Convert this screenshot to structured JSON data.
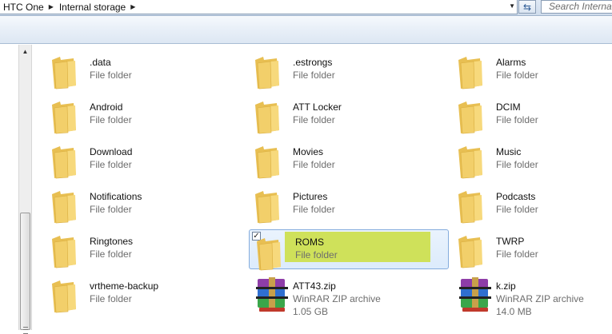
{
  "address": {
    "crumbs": [
      "HTC One",
      "Internal storage"
    ],
    "search_placeholder": "Search Internal storage"
  },
  "colors": {
    "selection_highlight": "#cfe15a",
    "selection_border": "#84acdd",
    "folder": "#f2cf6a"
  },
  "items": [
    {
      "name": ".data",
      "type": "File folder",
      "icon": "folder-icon"
    },
    {
      "name": ".estrongs",
      "type": "File folder",
      "icon": "folder-icon"
    },
    {
      "name": "Alarms",
      "type": "File folder",
      "icon": "folder-icon"
    },
    {
      "name": "Android",
      "type": "File folder",
      "icon": "folder-icon"
    },
    {
      "name": "ATT Locker",
      "type": "File folder",
      "icon": "folder-icon"
    },
    {
      "name": "DCIM",
      "type": "File folder",
      "icon": "folder-icon"
    },
    {
      "name": "Download",
      "type": "File folder",
      "icon": "folder-icon"
    },
    {
      "name": "Movies",
      "type": "File folder",
      "icon": "folder-icon"
    },
    {
      "name": "Music",
      "type": "File folder",
      "icon": "folder-icon"
    },
    {
      "name": "Notifications",
      "type": "File folder",
      "icon": "folder-icon"
    },
    {
      "name": "Pictures",
      "type": "File folder",
      "icon": "folder-icon"
    },
    {
      "name": "Podcasts",
      "type": "File folder",
      "icon": "folder-icon"
    },
    {
      "name": "Ringtones",
      "type": "File folder",
      "icon": "folder-icon"
    },
    {
      "name": "ROMS",
      "type": "File folder",
      "icon": "folder-icon",
      "selected": true
    },
    {
      "name": "TWRP",
      "type": "File folder",
      "icon": "folder-icon"
    },
    {
      "name": "vrtheme-backup",
      "type": "File folder",
      "icon": "folder-icon"
    },
    {
      "name": "ATT43.zip",
      "type": "WinRAR ZIP archive",
      "size": "1.05 GB",
      "icon": "winrar-zip-icon"
    },
    {
      "name": "k.zip",
      "type": "WinRAR ZIP archive",
      "size": "14.0 MB",
      "icon": "winrar-zip-icon"
    }
  ]
}
